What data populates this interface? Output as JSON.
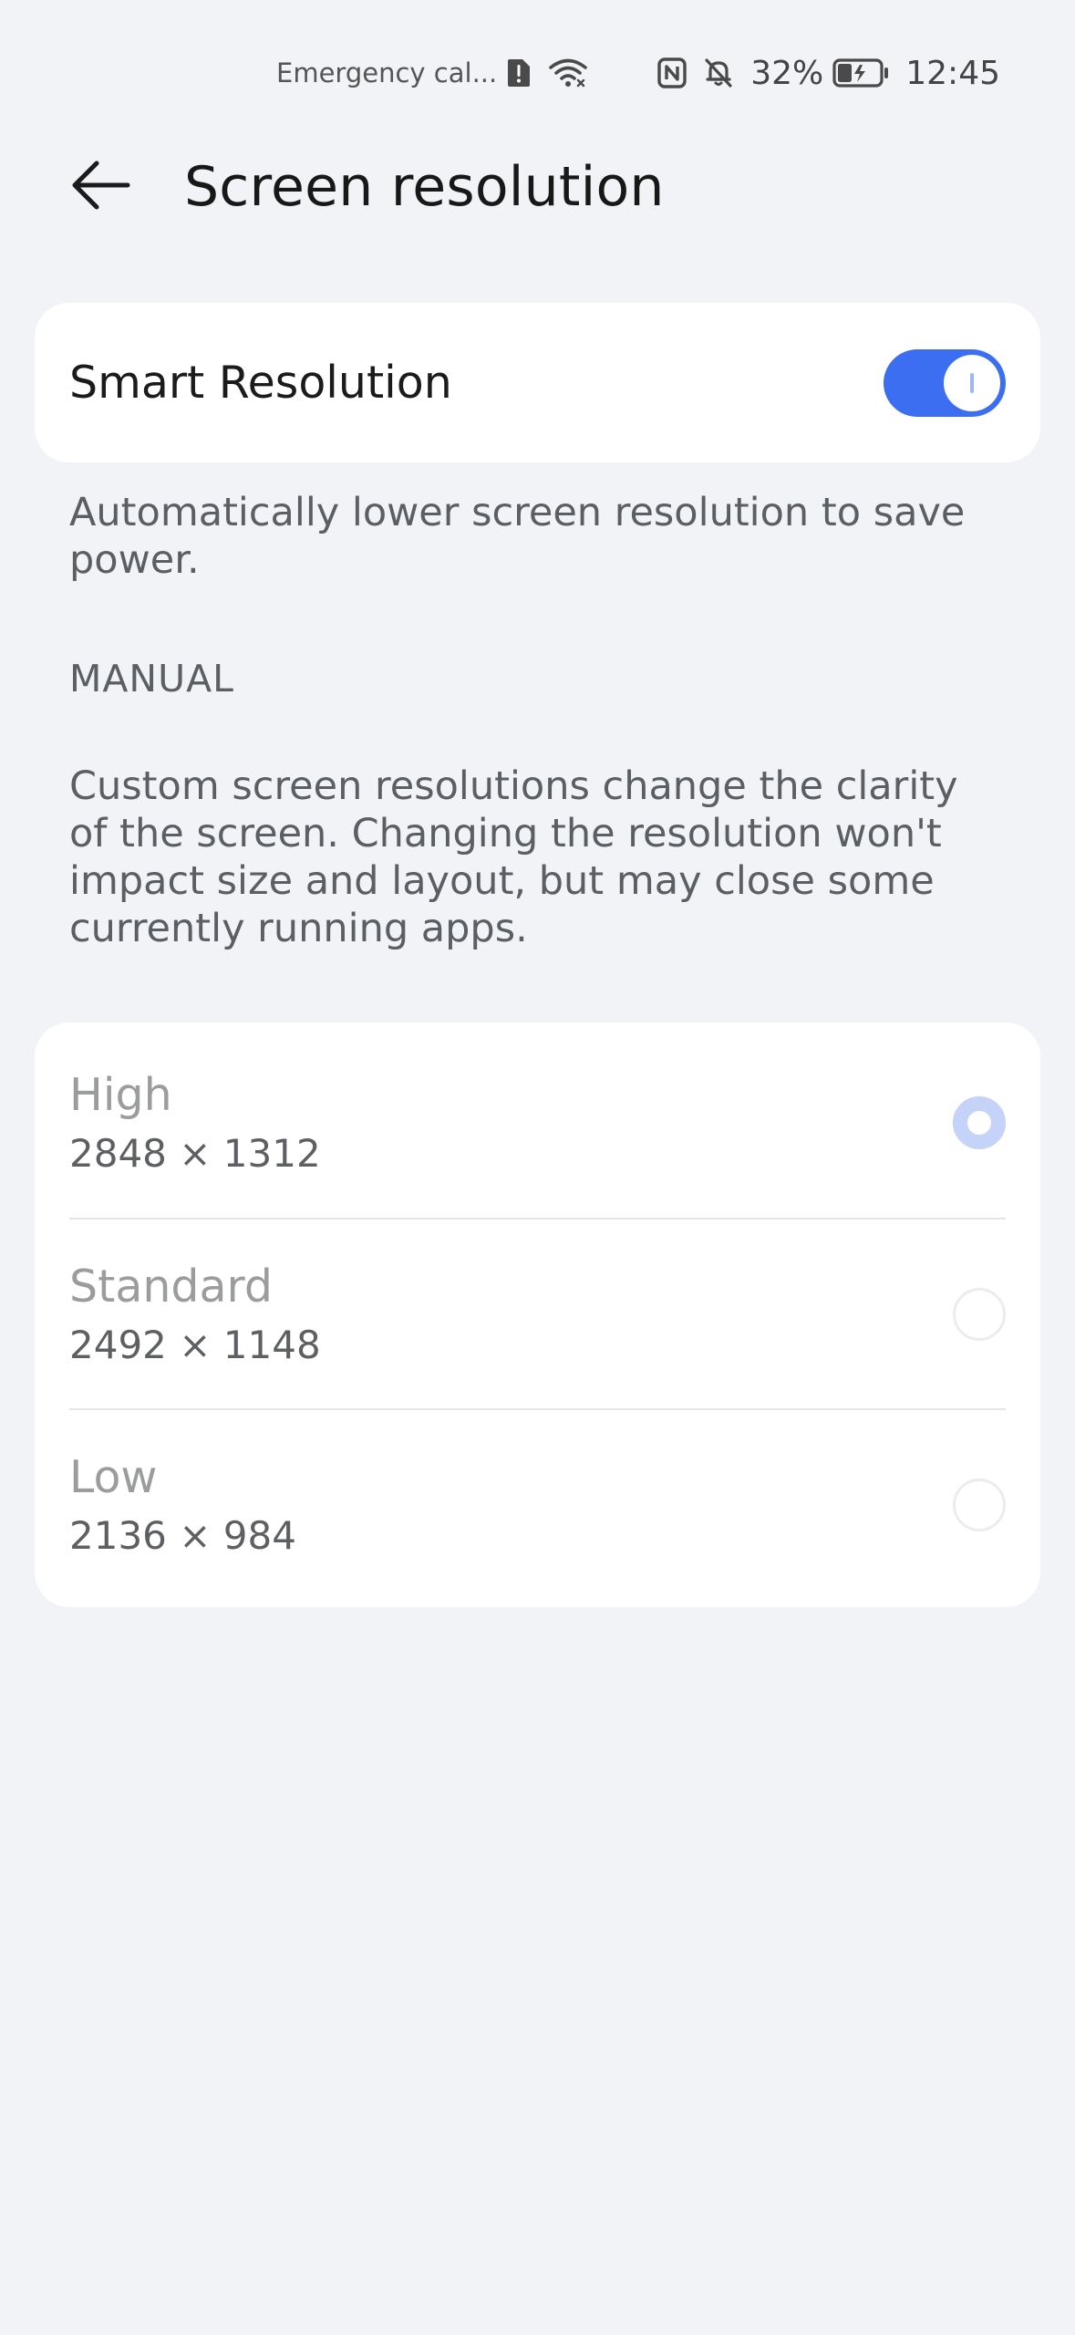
{
  "status_bar": {
    "carrier": "Emergency cal...",
    "battery": "32%",
    "time": "12:45",
    "icons": [
      "sim-alert-icon",
      "wifi-icon",
      "nfc-icon",
      "bell-off-icon",
      "battery-charging-icon"
    ]
  },
  "header": {
    "title": "Screen resolution",
    "back_icon": "arrow-left-icon"
  },
  "smart_resolution": {
    "label": "Smart Resolution",
    "enabled": true,
    "description": "Automatically lower screen resolution to save power."
  },
  "manual": {
    "section_title": "MANUAL",
    "description": "Custom screen resolutions change the clarity of the screen. Changing the resolution won't impact size and layout, but may close some currently running apps.",
    "options": [
      {
        "title": "High",
        "value": "2848 × 1312",
        "selected": true
      },
      {
        "title": "Standard",
        "value": "2492 × 1148",
        "selected": false
      },
      {
        "title": "Low",
        "value": "2136 × 984",
        "selected": false
      }
    ]
  },
  "colors": {
    "accent": "#3b6ef0",
    "background": "#f1f3f6",
    "card": "#ffffff"
  }
}
